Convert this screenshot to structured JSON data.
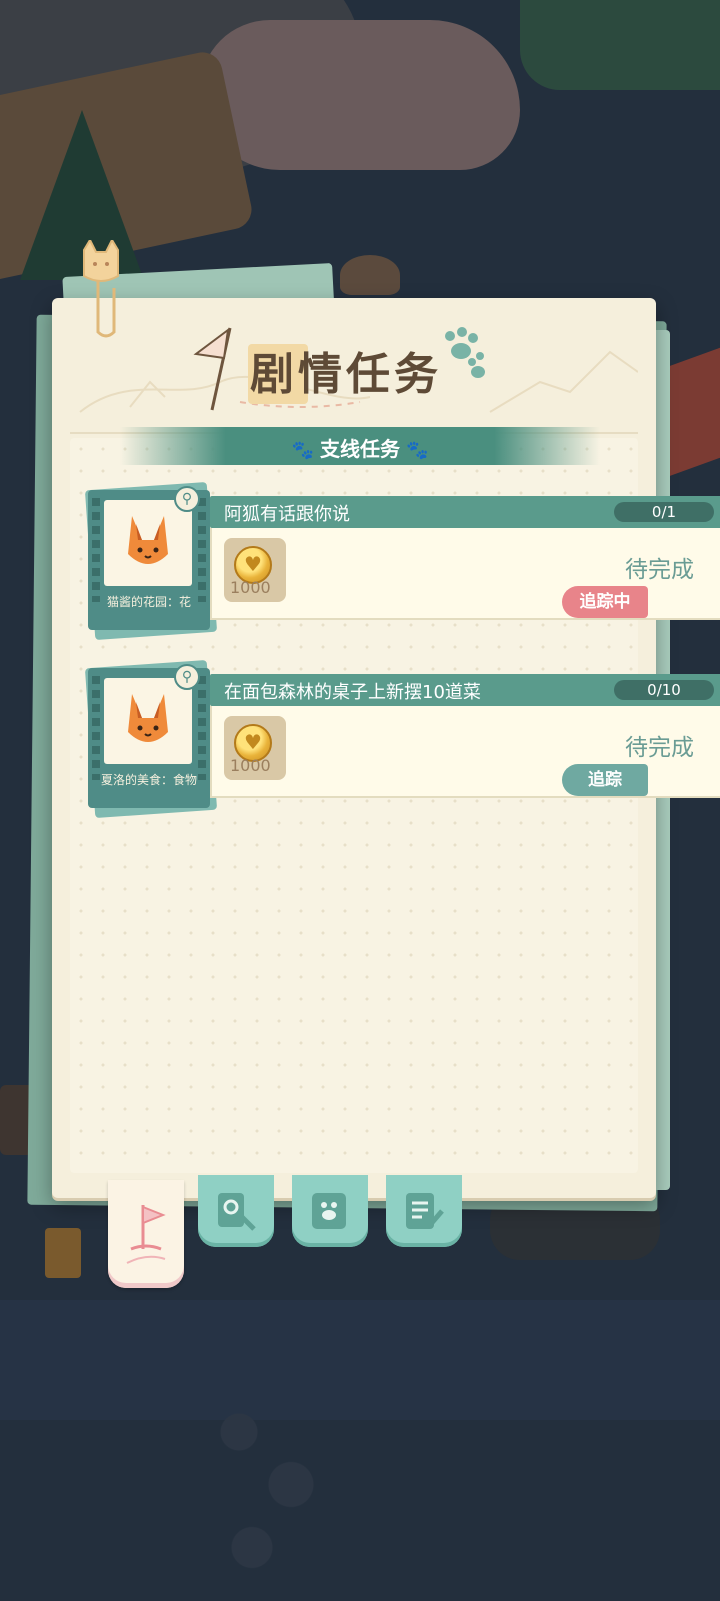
{
  "header": {
    "title": "剧情任务",
    "subtitle": "支线任务"
  },
  "quests": [
    {
      "card_label": "猫酱的花园：花",
      "name": "阿狐有话跟你说",
      "progress": "0/1",
      "reward_amount": "1000",
      "status": "待完成",
      "track_label": "追踪中",
      "track_color": "#e8848a"
    },
    {
      "card_label": "夏洛的美食：食物",
      "name": "在面包森林的桌子上新摆10道菜",
      "progress": "0/10",
      "reward_amount": "1000",
      "status": "待完成",
      "track_label": "追踪",
      "track_color": "#6fa9a1"
    }
  ],
  "tabs": [
    {
      "icon": "story-flag-icon",
      "active": true
    },
    {
      "icon": "settings-tools-icon",
      "active": false
    },
    {
      "icon": "pet-photo-icon",
      "active": false
    },
    {
      "icon": "notebook-edit-icon",
      "active": false
    }
  ],
  "colors": {
    "panel_bg": "#f5efdc",
    "accent_teal": "#5a9b8c",
    "title_brown": "#5e4a36",
    "status_green": "#6a9c94",
    "tracking_pink": "#e8848a"
  }
}
